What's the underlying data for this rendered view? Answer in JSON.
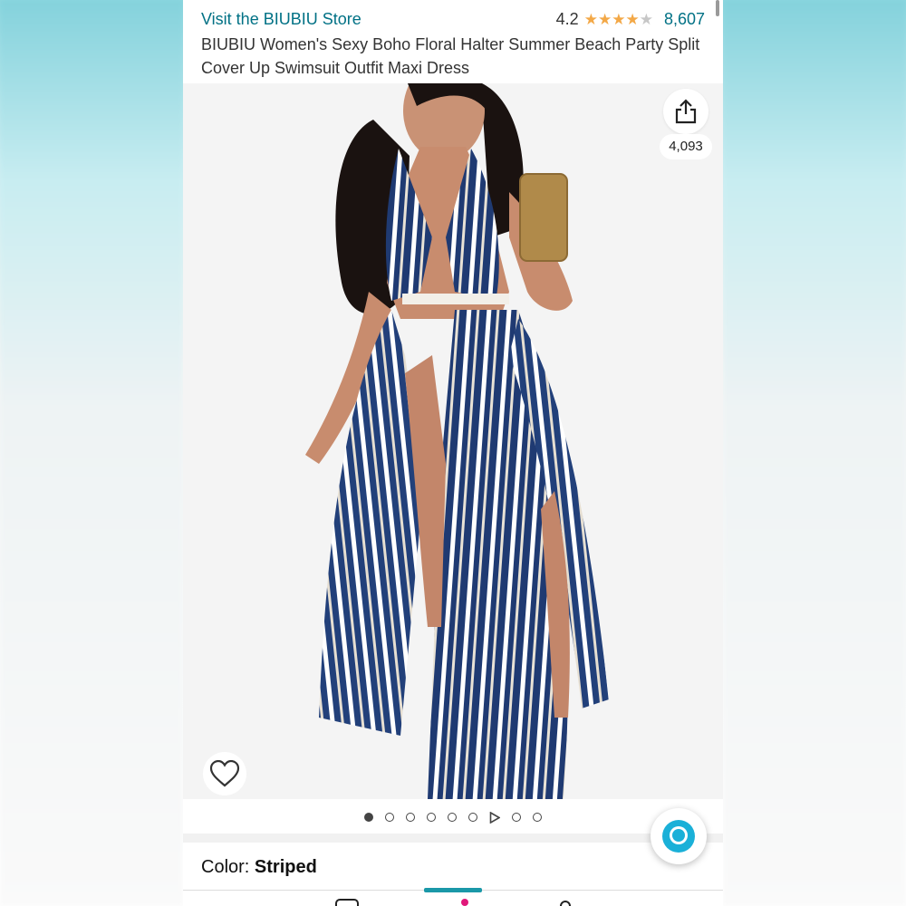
{
  "store": {
    "link_label": "Visit the BIUBIU Store"
  },
  "rating": {
    "value": "4.2",
    "stars_filled": 4,
    "stars_total": 5,
    "count": "8,607",
    "star_color": "#f3a847"
  },
  "product": {
    "title": "BIUBIU Women's Sexy Boho Floral Halter Summer Beach Party Split Cover Up Swimsuit Outfit Maxi Dress"
  },
  "image": {
    "share_icon": "share-icon",
    "share_count": "4,093",
    "wishlist_icon": "heart-icon"
  },
  "pager": {
    "total_dots": 9,
    "active_index": 0,
    "video_index": 6
  },
  "variant": {
    "color_label": "Color: ",
    "color_value": "Striped"
  },
  "assistant": {
    "icon": "alexa-icon",
    "color": "#1ab0d8"
  },
  "colors": {
    "link": "#007185",
    "text": "#333333"
  }
}
